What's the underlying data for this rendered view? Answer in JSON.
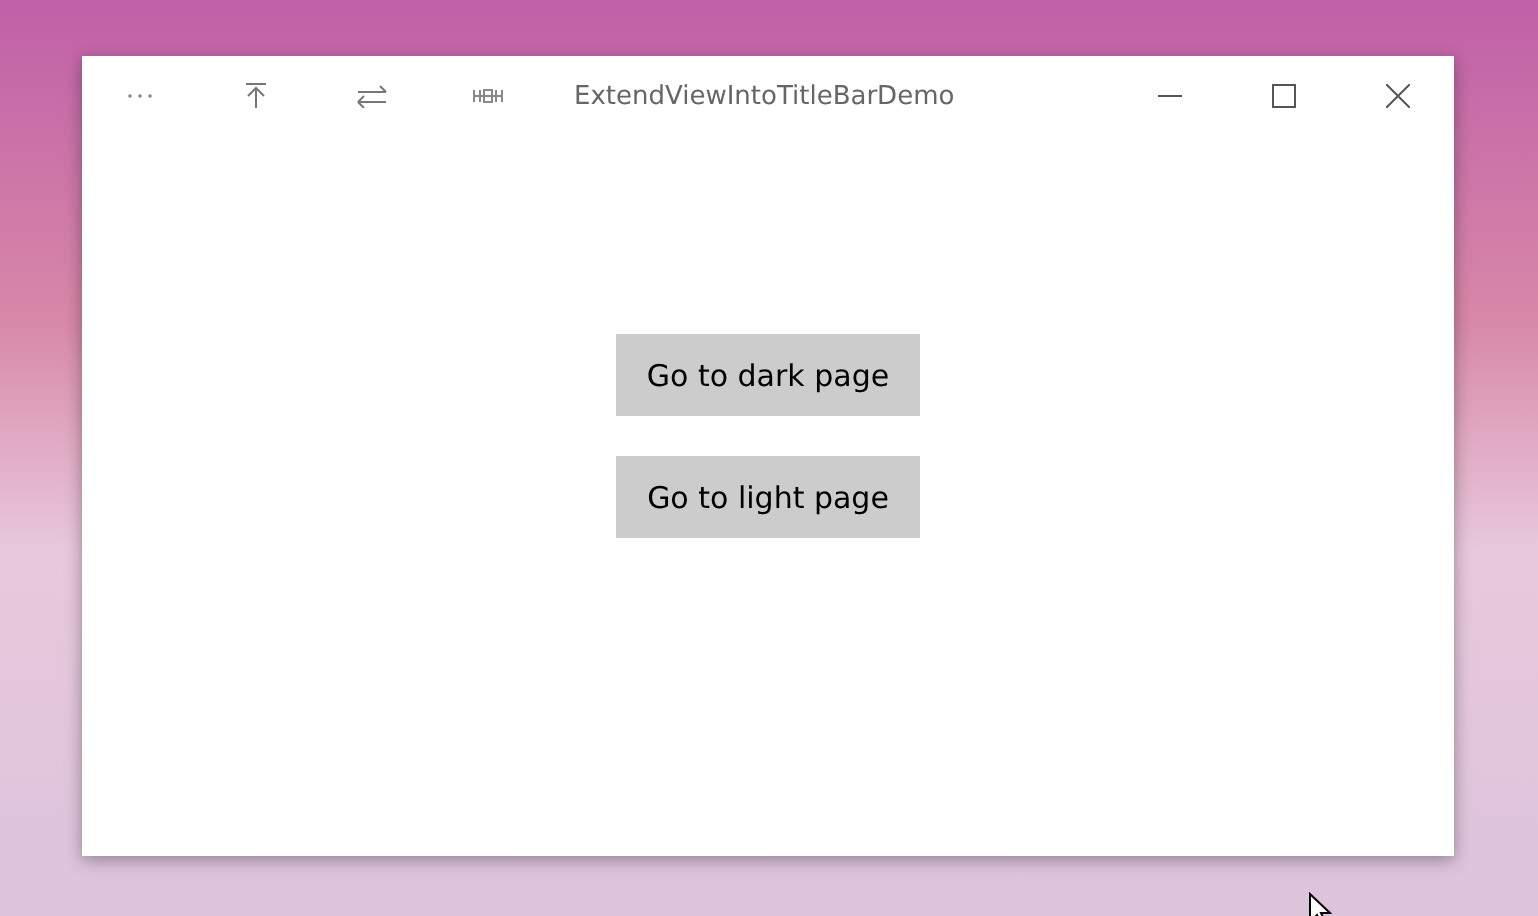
{
  "window": {
    "title": "ExtendViewIntoTitleBarDemo"
  },
  "buttons": [
    {
      "label": "Go to dark page"
    },
    {
      "label": "Go to light page"
    }
  ]
}
